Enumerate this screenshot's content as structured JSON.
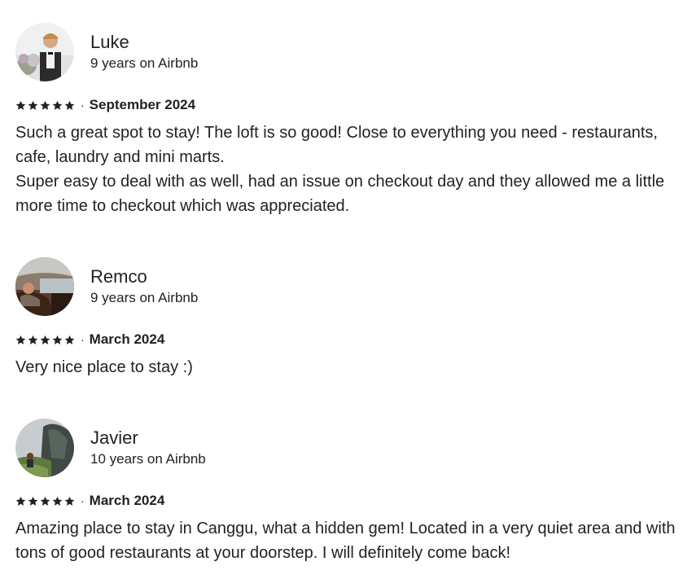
{
  "colors": {
    "text": "#222222",
    "star": "#222222",
    "background": "#ffffff"
  },
  "reviews": [
    {
      "name": "Luke",
      "tenure": "9 years on Airbnb",
      "rating": 5,
      "separator": "·",
      "date": "September 2024",
      "lines": [
        "Such a great spot to stay! The loft is so good! Close to everything you need - restaurants, cafe, laundry and mini marts.",
        "Super easy to deal with as well, had an issue on checkout day and they allowed me a little more time to checkout which was appreciated."
      ]
    },
    {
      "name": "Remco",
      "tenure": "9 years on Airbnb",
      "rating": 5,
      "separator": "·",
      "date": "March 2024",
      "lines": [
        "Very nice place to stay :)"
      ]
    },
    {
      "name": "Javier",
      "tenure": "10 years on Airbnb",
      "rating": 5,
      "separator": "·",
      "date": "March 2024",
      "lines": [
        "Amazing place to stay in Canggu, what a hidden gem! Located in a very quiet area and with tons of good restaurants at your doorstep. I will definitely come back!"
      ]
    }
  ]
}
